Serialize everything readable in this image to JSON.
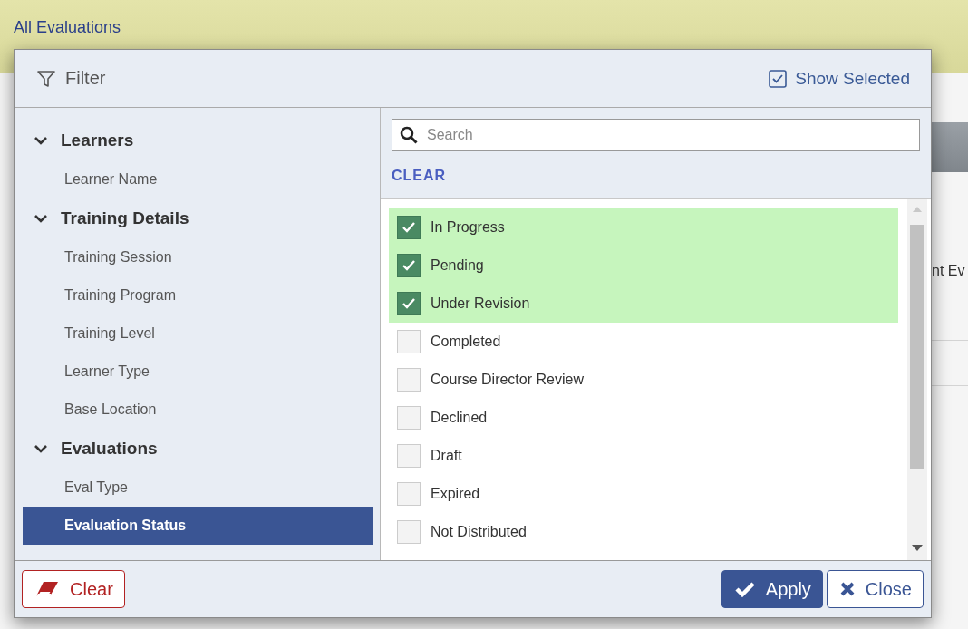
{
  "page": {
    "breadcrumb_link": "All Evaluations",
    "background_text": "nt Ev"
  },
  "dialog": {
    "title": "Filter",
    "show_selected": {
      "label": "Show Selected",
      "checked": true
    },
    "groups": [
      {
        "label": "Learners",
        "expanded": true,
        "children": [
          {
            "label": "Learner Name",
            "selected": false
          }
        ]
      },
      {
        "label": "Training Details",
        "expanded": true,
        "children": [
          {
            "label": "Training Session",
            "selected": false
          },
          {
            "label": "Training Program",
            "selected": false
          },
          {
            "label": "Training Level",
            "selected": false
          },
          {
            "label": "Learner Type",
            "selected": false
          },
          {
            "label": "Base Location",
            "selected": false
          }
        ]
      },
      {
        "label": "Evaluations",
        "expanded": true,
        "children": [
          {
            "label": "Eval Type",
            "selected": false
          },
          {
            "label": "Evaluation Status",
            "selected": true
          }
        ]
      }
    ],
    "search": {
      "placeholder": "Search"
    },
    "clear_link": "CLEAR",
    "options": [
      {
        "label": "In Progress",
        "checked": true
      },
      {
        "label": "Pending",
        "checked": true
      },
      {
        "label": "Under Revision",
        "checked": true
      },
      {
        "label": "Completed",
        "checked": false
      },
      {
        "label": "Course Director Review",
        "checked": false
      },
      {
        "label": "Declined",
        "checked": false
      },
      {
        "label": "Draft",
        "checked": false
      },
      {
        "label": "Expired",
        "checked": false
      },
      {
        "label": "Not Distributed",
        "checked": false
      }
    ],
    "buttons": [
      {
        "kind": "clear",
        "label": "Clear"
      },
      {
        "kind": "apply",
        "label": "Apply"
      },
      {
        "kind": "close",
        "label": "Close"
      }
    ]
  }
}
